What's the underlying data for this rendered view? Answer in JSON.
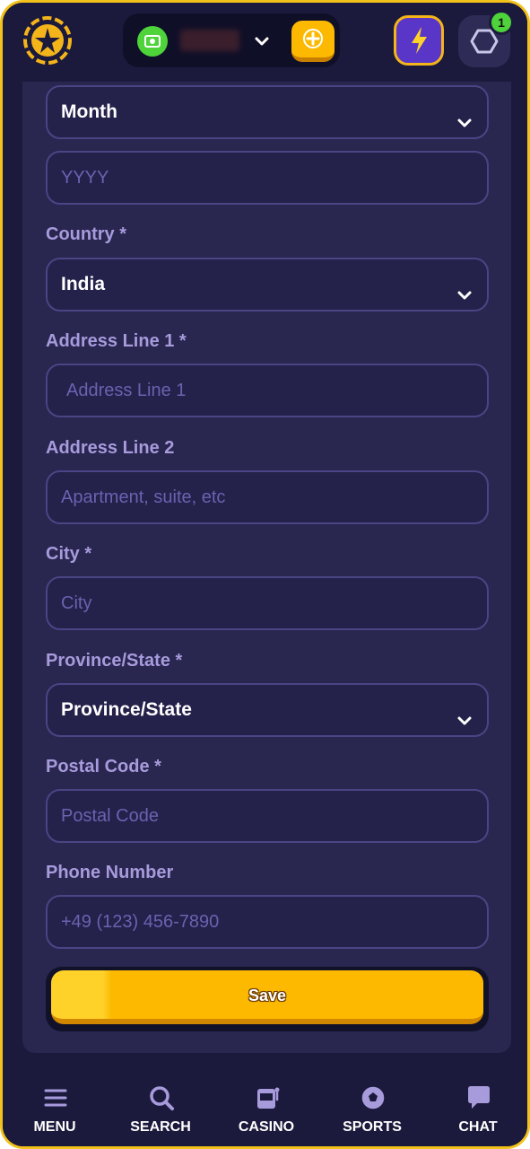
{
  "header": {
    "logo_icon": "star-coin-logo-icon",
    "wallet": {
      "cash_icon": "cash-icon",
      "balance": "",
      "dropdown_icon": "chevron-down-icon",
      "deposit_icon": "plus-icon"
    },
    "boost_icon": "lightning-bolt-icon",
    "rewards_icon": "hexagon-icon",
    "notification_count": "1"
  },
  "form": {
    "birth_month": {
      "value": "Month"
    },
    "birth_year": {
      "placeholder": "YYYY"
    },
    "country": {
      "label": "Country *",
      "value": "India"
    },
    "address1": {
      "label": "Address Line 1 *",
      "placeholder": "Address Line 1"
    },
    "address2": {
      "label": "Address Line 2",
      "placeholder": "Apartment, suite, etc"
    },
    "city": {
      "label": "City *",
      "placeholder": "City"
    },
    "province": {
      "label": "Province/State *",
      "value": "Province/State"
    },
    "postal": {
      "label": "Postal Code *",
      "placeholder": "Postal Code"
    },
    "phone": {
      "label": "Phone Number",
      "placeholder": "+49 (123) 456-7890"
    },
    "save_label": "Save"
  },
  "bottom_nav": {
    "menu": {
      "label": "MENU",
      "icon": "hamburger-menu-icon"
    },
    "search": {
      "label": "SEARCH",
      "icon": "search-icon"
    },
    "casino": {
      "label": "CASINO",
      "icon": "slot-machine-icon"
    },
    "sports": {
      "label": "SPORTS",
      "icon": "soccer-ball-icon"
    },
    "chat": {
      "label": "CHAT",
      "icon": "chat-bubble-icon"
    }
  },
  "colors": {
    "accent": "#fcb900",
    "background": "#1c1a3c",
    "panel": "#29264f",
    "label": "#a79bdc",
    "success": "#4ed33b"
  }
}
